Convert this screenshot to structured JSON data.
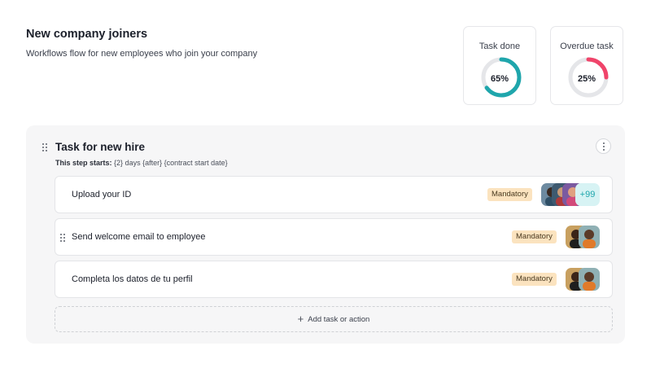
{
  "header": {
    "title": "New company joiners",
    "subtitle": "Workflows flow for new employees who join your company"
  },
  "kpis": [
    {
      "label": "Task done",
      "value_text": "65%",
      "value": 0.65,
      "color": "#1fa6ac"
    },
    {
      "label": "Overdue task",
      "value_text": "25%",
      "value": 0.25,
      "color": "#f0446a"
    }
  ],
  "section": {
    "title": "Task for new hire",
    "step_label": "This step starts:",
    "step_detail": "{2} days {after} {contract start date}",
    "add_label": "Add task or action"
  },
  "tasks": [
    {
      "label": "Upload your ID",
      "badge": "Mandatory",
      "more": "+99"
    },
    {
      "label": "Send welcome email to employee",
      "badge": "Mandatory"
    },
    {
      "label": "Completa los datos de tu perfil",
      "badge": "Mandatory"
    }
  ],
  "colors": {
    "badge_bg": "#fbe3bf",
    "accent_teal": "#1fa6ac",
    "accent_red": "#f0446a"
  }
}
